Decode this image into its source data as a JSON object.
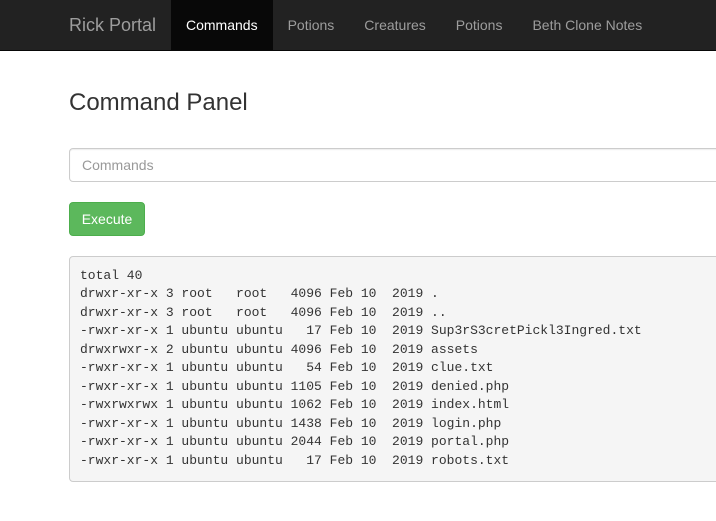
{
  "navbar": {
    "brand": "Rick Portal",
    "items": [
      {
        "label": "Commands",
        "active": true
      },
      {
        "label": "Potions",
        "active": false
      },
      {
        "label": "Creatures",
        "active": false
      },
      {
        "label": "Potions",
        "active": false
      },
      {
        "label": "Beth Clone Notes",
        "active": false
      }
    ]
  },
  "main": {
    "title": "Command Panel",
    "command_input": {
      "placeholder": "Commands",
      "value": ""
    },
    "execute_label": "Execute",
    "output_lines": [
      "total 40",
      "drwxr-xr-x 3 root   root   4096 Feb 10  2019 .",
      "drwxr-xr-x 3 root   root   4096 Feb 10  2019 ..",
      "-rwxr-xr-x 1 ubuntu ubuntu   17 Feb 10  2019 Sup3rS3cretPickl3Ingred.txt",
      "drwxrwxr-x 2 ubuntu ubuntu 4096 Feb 10  2019 assets",
      "-rwxr-xr-x 1 ubuntu ubuntu   54 Feb 10  2019 clue.txt",
      "-rwxr-xr-x 1 ubuntu ubuntu 1105 Feb 10  2019 denied.php",
      "-rwxrwxrwx 1 ubuntu ubuntu 1062 Feb 10  2019 index.html",
      "-rwxr-xr-x 1 ubuntu ubuntu 1438 Feb 10  2019 login.php",
      "-rwxr-xr-x 1 ubuntu ubuntu 2044 Feb 10  2019 portal.php",
      "-rwxr-xr-x 1 ubuntu ubuntu   17 Feb 10  2019 robots.txt"
    ]
  },
  "colors": {
    "navbar_bg": "#222222",
    "nav_active_bg": "#080808",
    "execute_button": "#5cb85c",
    "output_bg": "#f5f5f5"
  }
}
